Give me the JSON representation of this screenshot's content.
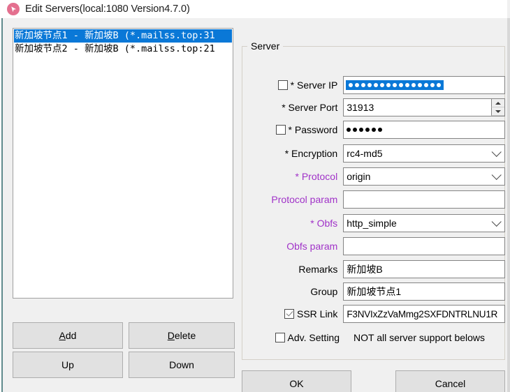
{
  "window": {
    "title": "Edit Servers(local:1080 Version4.7.0)",
    "icon": "ssr-app-icon"
  },
  "server_list": {
    "items": [
      {
        "label": "新加坡节点1 - 新加坡B (*.mailss.top:31",
        "selected": true
      },
      {
        "label": "新加坡节点2 - 新加坡B (*.mailss.top:21",
        "selected": false
      }
    ]
  },
  "list_buttons": {
    "add": "Add",
    "add_accel": "A",
    "add_rest": "dd",
    "delete": "Delete",
    "delete_accel": "D",
    "delete_rest": "elete",
    "up": "Up",
    "down": "Down"
  },
  "server_group": {
    "title": "Server",
    "fields": {
      "server_ip": {
        "label": "* Server IP",
        "checkbox_checked": false,
        "masked": true,
        "mask_dot_count": 15,
        "selected": true
      },
      "server_port": {
        "label": "* Server Port",
        "value": "31913",
        "has_spinner": true
      },
      "password": {
        "label": "* Password",
        "checkbox_checked": false,
        "masked": true,
        "mask_dot_count": 6,
        "selected": false
      },
      "encryption": {
        "label": "* Encryption",
        "value": "rc4-md5",
        "type": "combobox"
      },
      "protocol": {
        "label": "* Protocol",
        "value": "origin",
        "type": "combobox",
        "label_color": "#a032c8"
      },
      "protocol_param": {
        "label": "Protocol param",
        "value": "",
        "label_color": "#a032c8"
      },
      "obfs": {
        "label": "* Obfs",
        "value": "http_simple",
        "type": "combobox",
        "label_color": "#a032c8"
      },
      "obfs_param": {
        "label": "Obfs param",
        "value": "",
        "label_color": "#a032c8"
      },
      "remarks": {
        "label": "Remarks",
        "value": "新加坡B"
      },
      "group": {
        "label": "Group",
        "value": "新加坡节点1"
      },
      "ssr_link": {
        "label": "SSR Link",
        "checkbox_checked": true,
        "value": "F3NVIxZzVaMmg2SXFDNTRLNU1R"
      },
      "adv_setting": {
        "label": "Adv. Setting",
        "checkbox_checked": false,
        "note": "NOT all server support belows"
      }
    }
  },
  "dialog_buttons": {
    "ok": "OK",
    "cancel": "Cancel"
  },
  "colors": {
    "selection_blue": "#0a78d7",
    "purple_label": "#a032c8",
    "window_bg": "#f0f0f0",
    "button_bg": "#e1e1e1"
  }
}
